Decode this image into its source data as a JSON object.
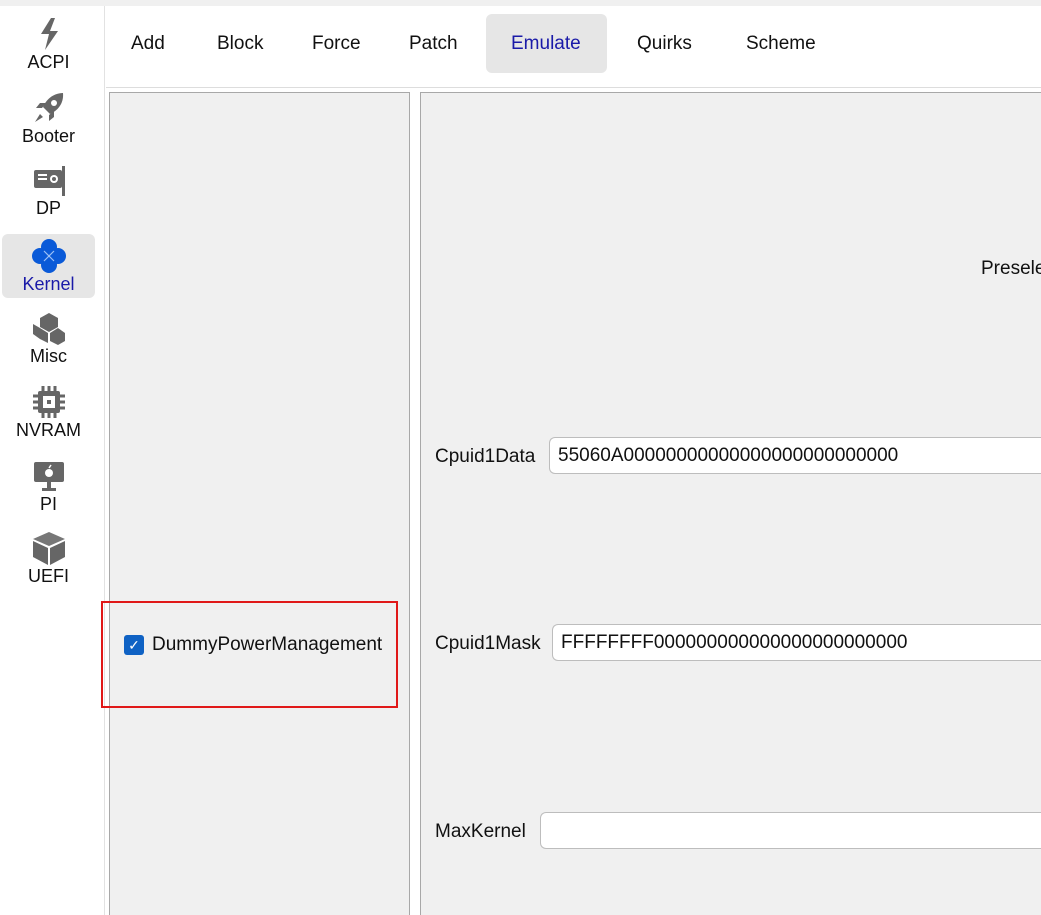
{
  "sidebar": {
    "items": [
      {
        "label": "ACPI",
        "icon": "lightning-icon"
      },
      {
        "label": "Booter",
        "icon": "rocket-icon"
      },
      {
        "label": "DP",
        "icon": "graphics-card-icon"
      },
      {
        "label": "Kernel",
        "icon": "kernel-icon",
        "active": true
      },
      {
        "label": "Misc",
        "icon": "cubes-icon"
      },
      {
        "label": "NVRAM",
        "icon": "chip-icon"
      },
      {
        "label": "PI",
        "icon": "apple-monitor-icon"
      },
      {
        "label": "UEFI",
        "icon": "box-icon"
      }
    ]
  },
  "tabs": [
    "Add",
    "Block",
    "Force",
    "Patch",
    "Emulate",
    "Quirks",
    "Scheme"
  ],
  "active_tab": "Emulate",
  "left": {
    "checkbox_label": "DummyPowerManagement",
    "checked": true
  },
  "right": {
    "preselect_label": "Presele",
    "cpuid1data_label": "Cpuid1Data",
    "cpuid1data_value": "55060A00000000000000000000000000",
    "cpuid1mask_label": "Cpuid1Mask",
    "cpuid1mask_value": "FFFFFFFF000000000000000000000000",
    "maxkernel_label": "MaxKernel",
    "maxkernel_value": ""
  },
  "colors": {
    "accent": "#0f62c4",
    "active_text": "#1a1aa8",
    "highlight": "#e01818"
  }
}
